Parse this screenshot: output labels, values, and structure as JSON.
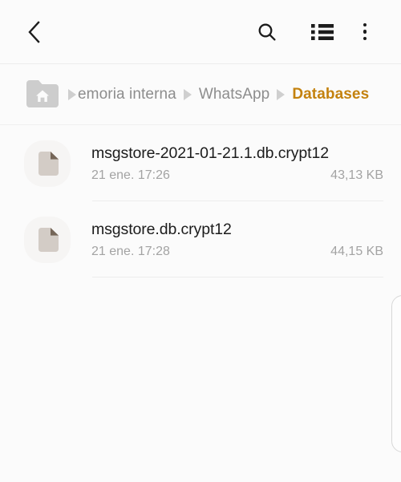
{
  "appbar": {
    "back_label": "Back",
    "icons": [
      {
        "name": "back-icon",
        "label": "Back"
      },
      {
        "name": "search-icon",
        "label": "Search"
      },
      {
        "name": "list-view-icon",
        "label": "View as list"
      },
      {
        "name": "more-options-icon",
        "label": "More options"
      }
    ]
  },
  "breadcrumb": {
    "home_icon": "home-folder-icon",
    "separator": "triangle-right",
    "items": [
      {
        "label": "emoria interna",
        "current": false
      },
      {
        "label": "WhatsApp",
        "current": false
      },
      {
        "label": "Databases",
        "current": true
      }
    ],
    "current_color": "#c4820e",
    "inactive_color": "#8d8d8d"
  },
  "files": [
    {
      "icon": "document-file-icon",
      "name": "msgstore-2021-01-21.1.db.crypt12",
      "date": "21 ene. 17:26",
      "size": "43,13 KB"
    },
    {
      "icon": "document-file-icon",
      "name": "msgstore.db.crypt12",
      "date": "21 ene. 17:28",
      "size": "44,15 KB"
    }
  ],
  "scrollbar": {
    "name": "fast-scroll-handle"
  },
  "colors": {
    "background": "#fbfbfb",
    "text_primary": "#1c1c1c",
    "text_secondary": "#a3a3a3",
    "divider": "#ececec",
    "accent": "#c4820e",
    "file_icon_bg": "#f6f5f4",
    "file_icon_doc": "#d3ccc6"
  }
}
